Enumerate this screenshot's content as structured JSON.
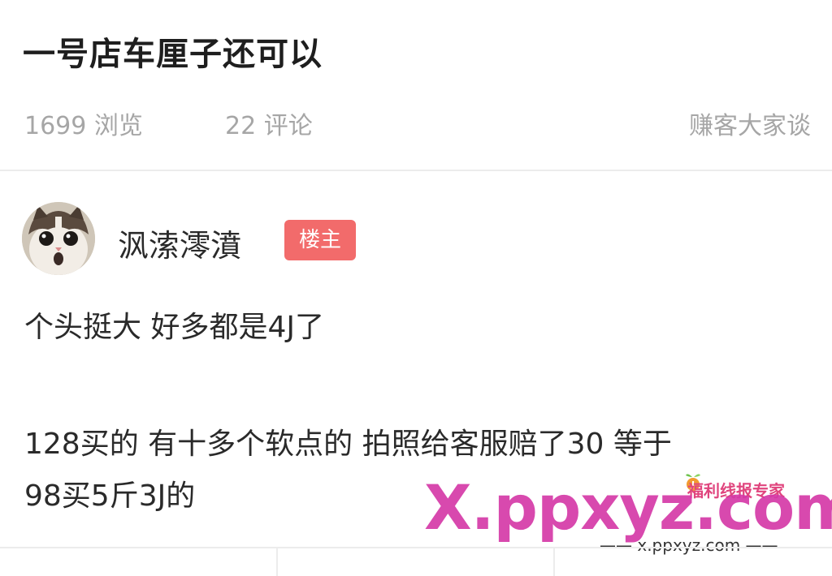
{
  "post": {
    "title": "一号店车厘子还可以",
    "views": "1699 浏览",
    "comments": "22 评论",
    "tag": "赚客大家谈"
  },
  "author": {
    "name": "沨溹澪濆",
    "badge": "楼主"
  },
  "content": {
    "line1": "个头挺大 好多都是4J了",
    "line2": "128买的 有十多个软点的 拍照给客服赔了30   等于",
    "line3": "98买5斤3J的"
  },
  "watermark": {
    "brand": "福利线报专家",
    "logo_text": "X.ppxyz.com",
    "url": "—— x.ppxyz.com ——"
  }
}
